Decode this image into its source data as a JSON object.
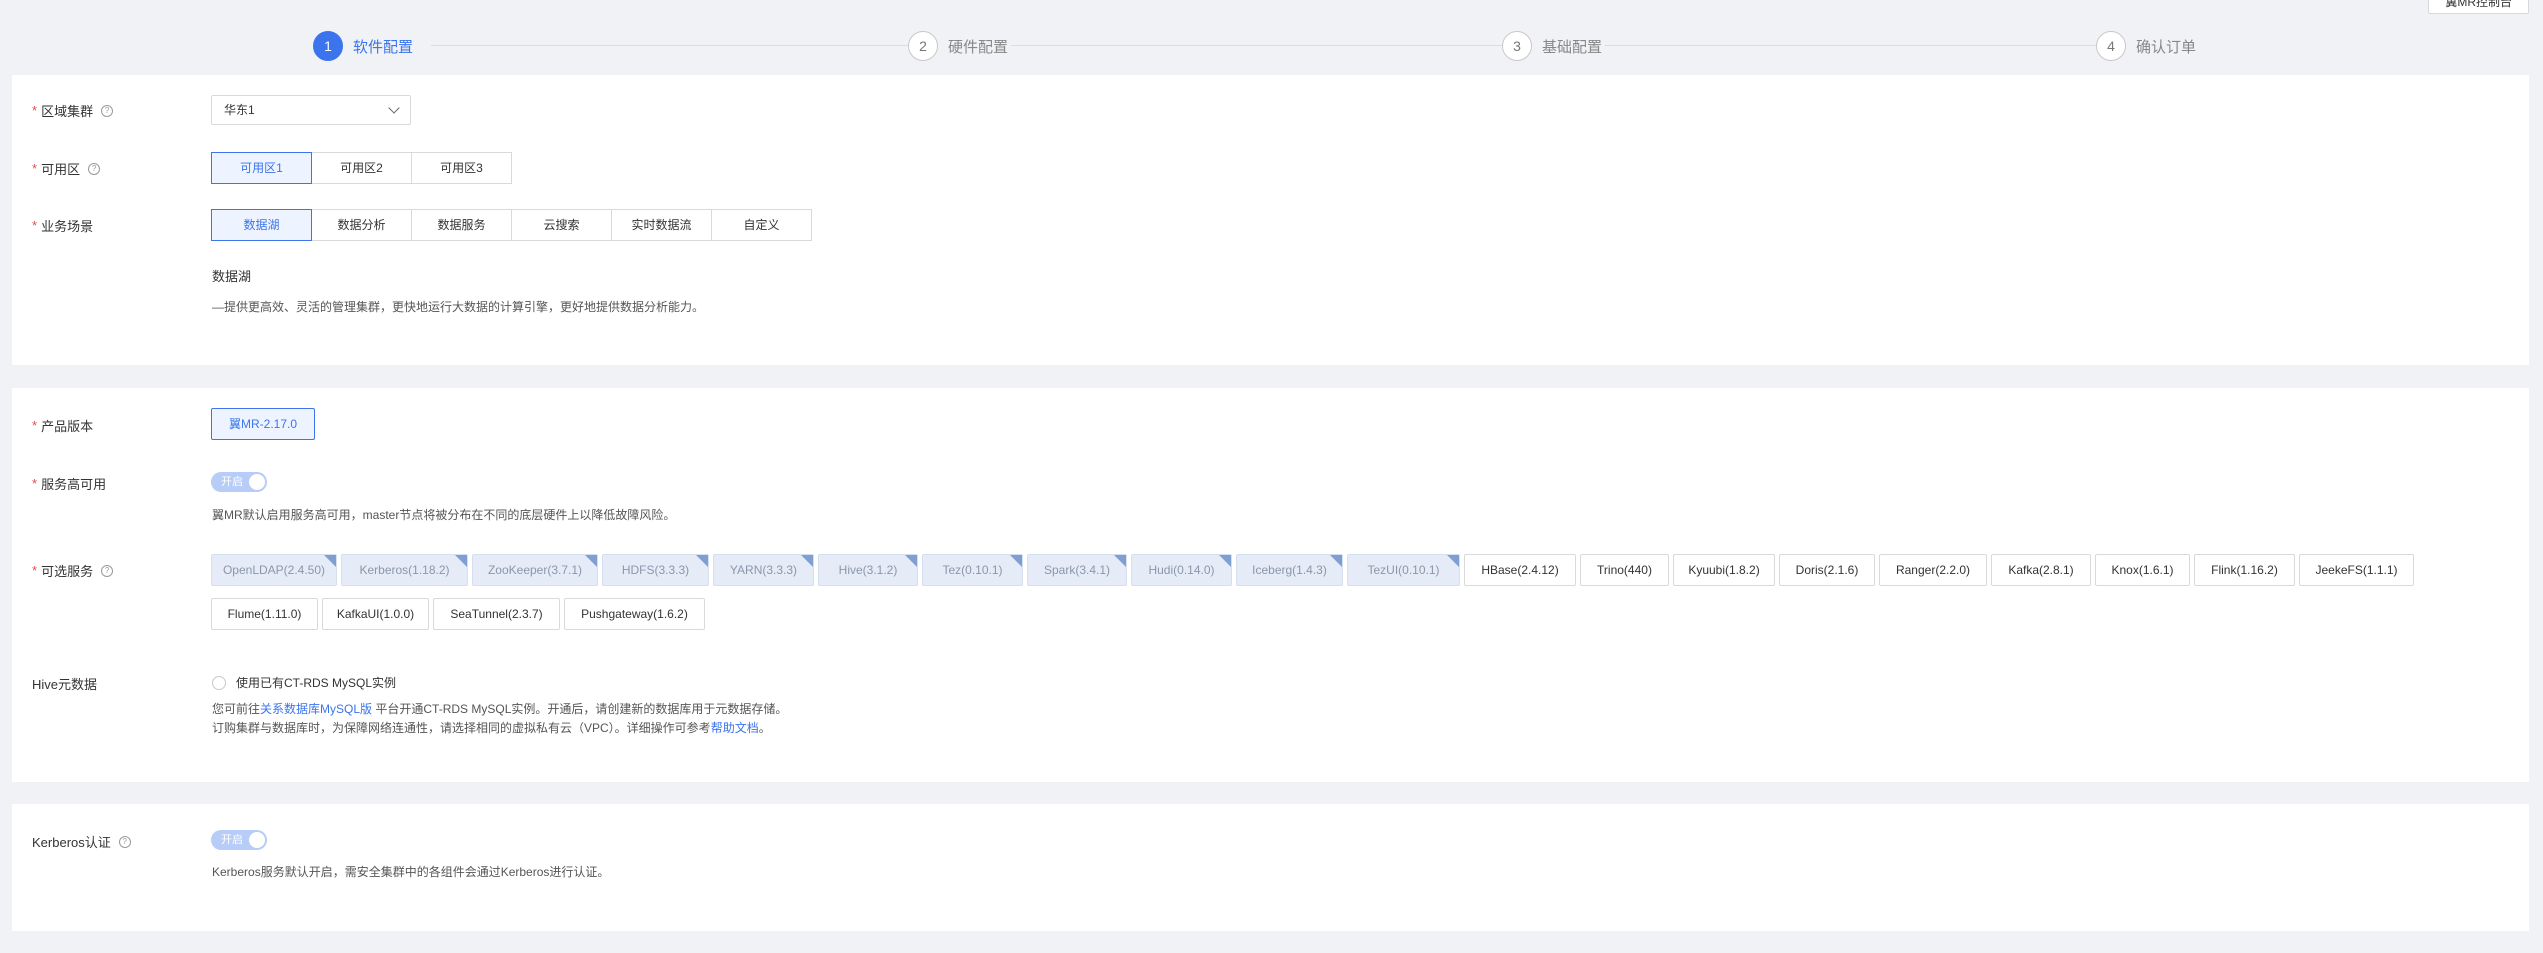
{
  "top_button": {
    "label": "翼MR控制台"
  },
  "steps": [
    {
      "num": "1",
      "label": "软件配置"
    },
    {
      "num": "2",
      "label": "硬件配置"
    },
    {
      "num": "3",
      "label": "基础配置"
    },
    {
      "num": "4",
      "label": "确认订单"
    }
  ],
  "section1": {
    "region_label": "区域集群",
    "region_value": "华东1",
    "zone_label": "可用区",
    "zones": [
      "可用区1",
      "可用区2",
      "可用区3"
    ],
    "scene_label": "业务场景",
    "scenes": [
      "数据湖",
      "数据分析",
      "数据服务",
      "云搜索",
      "实时数据流",
      "自定义"
    ],
    "scene_title": "数据湖",
    "scene_desc": "—提供更高效、灵活的管理集群，更快地运行大数据的计算引擎，更好地提供数据分析能力。"
  },
  "section2": {
    "version_label": "产品版本",
    "version_value": "翼MR-2.17.0",
    "ha_label": "服务高可用",
    "ha_switch": "开启",
    "ha_desc": "翼MR默认启用服务高可用，master节点将被分布在不同的底层硬件上以降低故障风险。",
    "services_label": "可选服务",
    "services": [
      "OpenLDAP(2.4.50)",
      "Kerberos(1.18.2)",
      "ZooKeeper(3.7.1)",
      "HDFS(3.3.3)",
      "YARN(3.3.3)",
      "Hive(3.1.2)",
      "Tez(0.10.1)",
      "Spark(3.4.1)",
      "Hudi(0.14.0)",
      "Iceberg(1.4.3)",
      "TezUI(0.10.1)",
      "HBase(2.4.12)",
      "Trino(440)",
      "Kyuubi(1.8.2)",
      "Doris(2.1.6)",
      "Ranger(2.2.0)",
      "Kafka(2.8.1)",
      "Knox(1.6.1)",
      "Flink(1.16.2)",
      "JeekeFS(1.1.1)",
      "Flume(1.11.0)",
      "KafkaUI(1.0.0)",
      "SeaTunnel(2.3.7)",
      "Pushgateway(1.6.2)"
    ],
    "hive_label": "Hive元数据",
    "hive_checkbox": "使用已有CT-RDS MySQL实例",
    "hive_line1_a": "您可前往",
    "hive_line1_link": "关系数据库MySQL版",
    "hive_line1_b": " 平台开通CT-RDS MySQL实例。开通后，请创建新的数据库用于元数据存储。",
    "hive_line2_a": "订购集群与数据库时，为保障网络连通性，请选择相同的虚拟私有云（VPC）。详细操作可参考",
    "hive_line2_link": "帮助文档",
    "hive_line2_b": "。"
  },
  "section3": {
    "kerberos_label": "Kerberos认证",
    "kerberos_switch": "开启",
    "kerberos_desc": "Kerberos服务默认开启，需安全集群中的各组件会通过Kerberos进行认证。"
  },
  "colors": {
    "accent": "#3b74ec",
    "required": "#e34d4d",
    "fixed_chip_bg": "#e5ecf7"
  }
}
